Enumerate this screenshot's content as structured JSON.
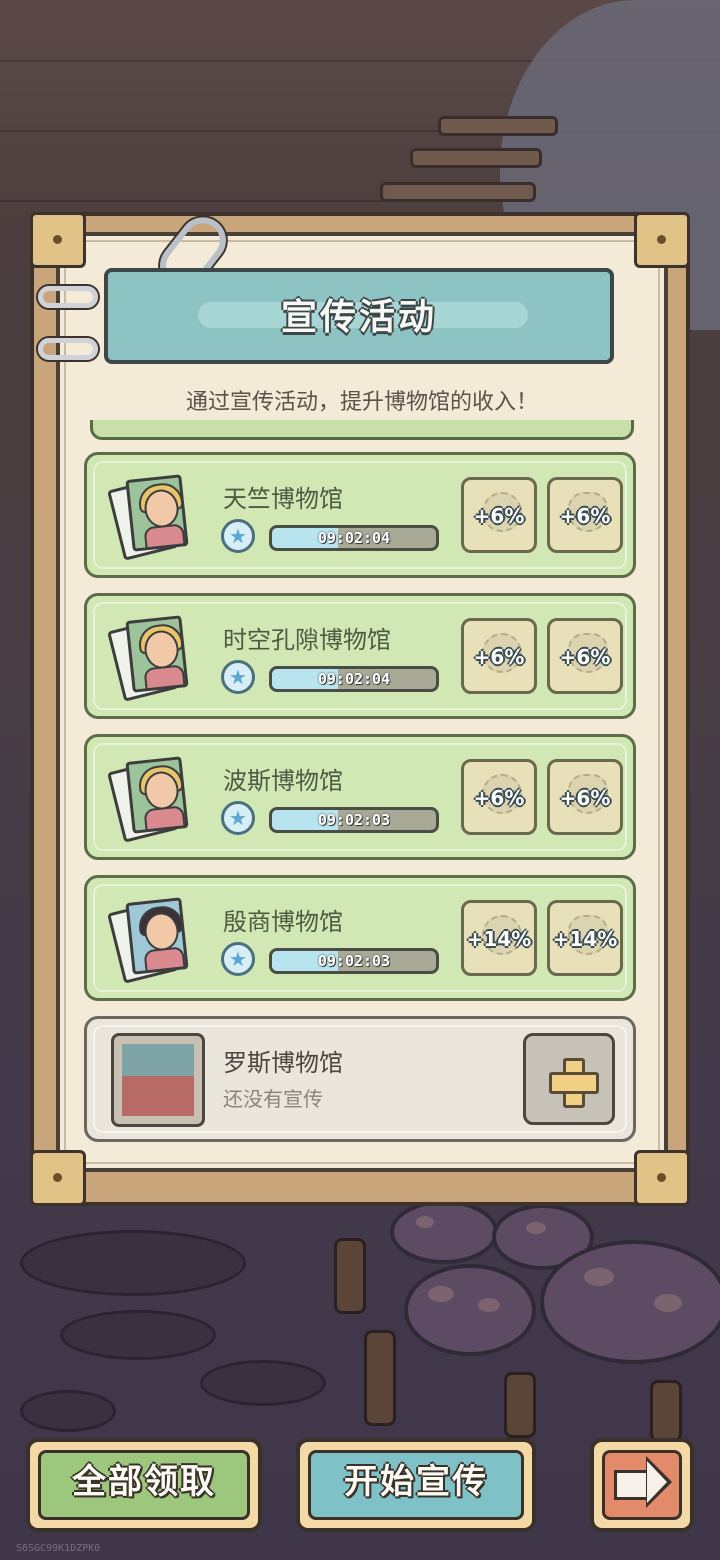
{
  "dialog": {
    "title": "宣传活动",
    "subtitle": "通过宣传活动，提升博物馆的收入！"
  },
  "campaigns": [
    {
      "name": "天竺博物馆",
      "timer": "09:02:04",
      "timer_progress": 0.4,
      "bonus_ribbon": "+6%",
      "bonus_hat": "+6%",
      "portrait": "blonde-lady-photos"
    },
    {
      "name": "时空孔隙博物馆",
      "timer": "09:02:04",
      "timer_progress": 0.4,
      "bonus_ribbon": "+6%",
      "bonus_hat": "+6%",
      "portrait": "blonde-lady-photos"
    },
    {
      "name": "波斯博物馆",
      "timer": "09:02:03",
      "timer_progress": 0.4,
      "bonus_ribbon": "+6%",
      "bonus_hat": "+6%",
      "portrait": "blonde-lady-photos"
    },
    {
      "name": "殷商博物馆",
      "timer": "09:02:03",
      "timer_progress": 0.4,
      "bonus_ribbon": "+14%",
      "bonus_hat": "+14%",
      "portrait": "dark-hair-lady-photos"
    }
  ],
  "locked": {
    "name": "罗斯博物馆",
    "status": "还没有宣传"
  },
  "buttons": {
    "collect_all": "全部领取",
    "start_campaign": "开始宣传",
    "next_icon": "arrow-right-icon"
  },
  "watermark": "S6SGC99K1DZPK0",
  "colors": {
    "card_green": "#d2e8b4",
    "title_teal": "#8ec3c4",
    "collect_green": "#9cc77d",
    "start_teal": "#7ec2c8",
    "next_orange": "#e38a6b"
  }
}
